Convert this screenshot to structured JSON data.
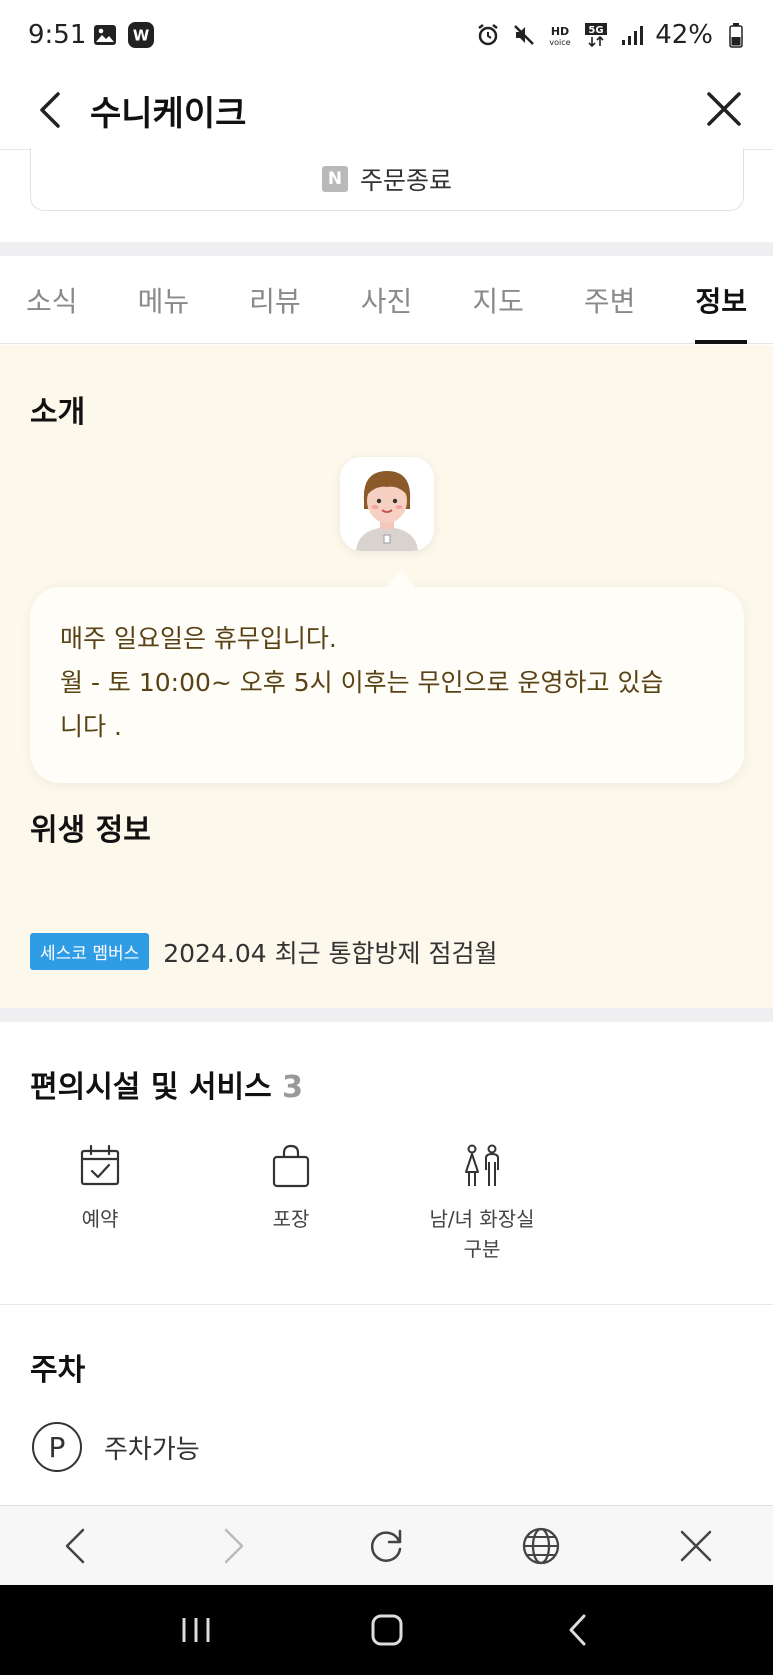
{
  "status_bar": {
    "time": "9:51",
    "battery": "42%",
    "icons": [
      "image-icon",
      "w-app-icon",
      "alarm-icon",
      "mute-icon",
      "hd-voice-icon",
      "5g-icon",
      "signal-icon",
      "battery-icon"
    ]
  },
  "header": {
    "title": "수니케이크"
  },
  "order": {
    "badge": "N",
    "label": "주문종료"
  },
  "tabs": [
    {
      "label": "소식",
      "active": false
    },
    {
      "label": "메뉴",
      "active": false
    },
    {
      "label": "리뷰",
      "active": false
    },
    {
      "label": "사진",
      "active": false
    },
    {
      "label": "지도",
      "active": false
    },
    {
      "label": "주변",
      "active": false
    },
    {
      "label": "정보",
      "active": true
    }
  ],
  "intro": {
    "title": "소개",
    "lines": [
      "매주 일요일은 휴무입니다.",
      "월 - 토 10:00~ 오후 5시 이후는 무인으로 운영하고 있습",
      "니다 ."
    ]
  },
  "hygiene": {
    "title": "위생 정보",
    "badge": "세스코 멤버스",
    "text": "2024.04 최근 통합방제 점검월"
  },
  "facilities": {
    "title": "편의시설 및 서비스",
    "count": "3",
    "items": [
      {
        "label": "예약",
        "icon": "calendar-check-icon"
      },
      {
        "label": "포장",
        "icon": "shopping-bag-icon"
      },
      {
        "label_line1": "남/녀 화장실",
        "label_line2": "구분",
        "icon": "restroom-icon"
      }
    ]
  },
  "parking": {
    "title": "주차",
    "icon_letter": "P",
    "text": "주차가능"
  },
  "colors": {
    "intro_bg": "#fdf8ec",
    "bubble_text": "#5a4217",
    "sesco_blue": "#2f9ce6"
  }
}
